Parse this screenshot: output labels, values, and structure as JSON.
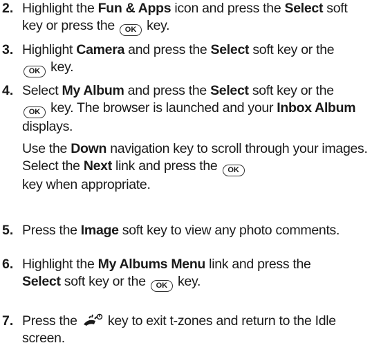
{
  "ok_key": "OK",
  "steps": [
    {
      "number": "2.",
      "parts": [
        "Highlight the ",
        "Fun & Apps",
        " icon and press the ",
        "Select",
        " soft key or press the ",
        " key."
      ]
    },
    {
      "number": "3.",
      "parts": [
        "Highlight ",
        "Camera",
        " and press the ",
        "Select",
        " soft key or the ",
        " key."
      ]
    },
    {
      "number": "4.",
      "parts": [
        "Select ",
        "My Album",
        " and press the ",
        "Select",
        " soft key or the ",
        " key. The browser is launched and your ",
        "Inbox Album",
        " displays."
      ]
    },
    {
      "number": "",
      "parts": [
        "Use the ",
        "Down",
        " navigation key to scroll through your images. Select the ",
        "Next",
        " link and press the ",
        " key when appropriate."
      ]
    },
    {
      "number": "5.",
      "parts": [
        " Press the ",
        "Image",
        " soft key to view any photo comments."
      ]
    },
    {
      "number": "6.",
      "parts": [
        "Highlight the ",
        "My Albums Menu",
        " link and press the ",
        "Select",
        " soft key or the ",
        " key."
      ]
    },
    {
      "number": "7.",
      "parts": [
        "Press the ",
        " key to exit t-zones and return to the Idle screen."
      ]
    }
  ],
  "icons": {
    "ok": "ok-key-icon",
    "end": "end-power-key-icon"
  }
}
